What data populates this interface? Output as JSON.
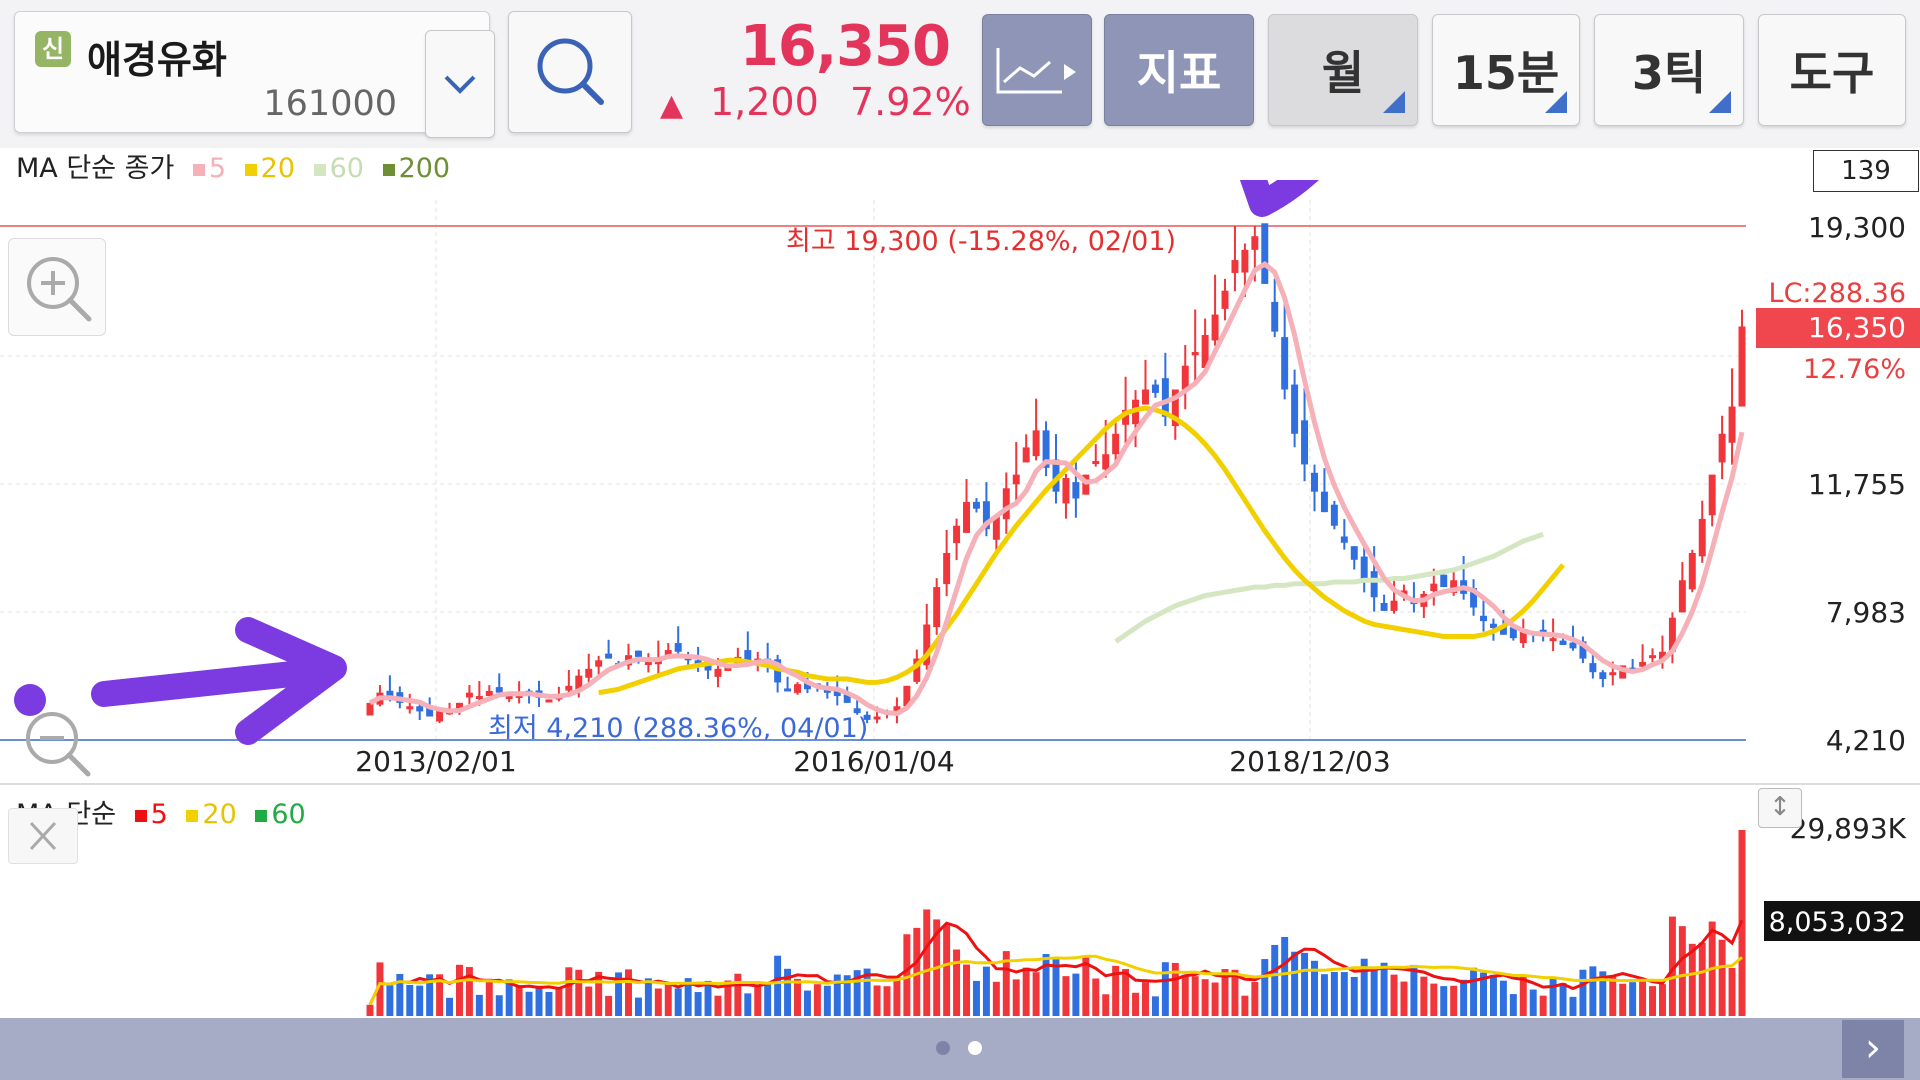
{
  "stock": {
    "badge": "신",
    "name": "애경유화",
    "code": "161000",
    "price": "16,350",
    "change_arrow": "▲",
    "change": "1,200",
    "change_pct": "7.92%"
  },
  "toolbar": {
    "chart_type_icon": "line-chart-icon",
    "indicator_label": "지표",
    "period_month": "월",
    "period_15min": "15분",
    "tick_3": "3틱",
    "tools": "도구"
  },
  "price_chart": {
    "legend_title": "MA 단순 종가",
    "legend_items": [
      {
        "label": "5",
        "color": "#f6b0b8"
      },
      {
        "label": "20",
        "color": "#f2d000"
      },
      {
        "label": "60",
        "color": "#d4e6c2"
      },
      {
        "label": "200",
        "color": "#6e8f33"
      }
    ],
    "candle_count": "139",
    "high_annotation": "최고 19,300 (-15.28%, 02/01)",
    "low_annotation": "최저 4,210 (288.36%, 04/01)",
    "lc_label": "LC:288.36",
    "current_price_tag": "16,350",
    "current_pct": "12.76%",
    "y_ticks": [
      "19,300",
      "11,755",
      "7,983",
      "4,210"
    ],
    "x_ticks": [
      "2013/02/01",
      "2016/01/04",
      "2018/12/03"
    ]
  },
  "volume_chart": {
    "legend_title": "MA 단순",
    "legend_items": [
      {
        "label": "5",
        "color": "#ee1111"
      },
      {
        "label": "20",
        "color": "#f2d000"
      },
      {
        "label": "60",
        "color": "#22aa44"
      }
    ],
    "max_label": "29,893K",
    "current_volume": "8,053,032"
  },
  "chart_data": {
    "type": "candlestick",
    "title": "애경유화",
    "interval": "월",
    "x_ticks": [
      "2013/02/01",
      "2016/01/04",
      "2018/12/03"
    ],
    "ylim": [
      4210,
      19300
    ],
    "y_ticks": [
      19300,
      11755,
      7983,
      4210
    ],
    "price_series": [
      5300,
      5600,
      5450,
      5300,
      5200,
      5050,
      4900,
      5100,
      5050,
      5300,
      5600,
      5500,
      5650,
      5600,
      5500,
      5600,
      5500,
      5450,
      5400,
      5550,
      5800,
      6100,
      6300,
      6550,
      6600,
      6400,
      6700,
      6650,
      6500,
      6600,
      6850,
      6800,
      6550,
      6400,
      6250,
      6300,
      6400,
      6650,
      6550,
      6600,
      6450,
      5900,
      5650,
      5850,
      5700,
      5800,
      5650,
      5500,
      5300,
      5000,
      4800,
      4900,
      5050,
      5200,
      5800,
      6600,
      7600,
      8700,
      9700,
      10500,
      11200,
      11000,
      10400,
      10800,
      11600,
      12000,
      12800,
      13300,
      12200,
      11500,
      11900,
      11300,
      12000,
      12400,
      12600,
      13200,
      13900,
      14200,
      14500,
      14400,
      13700,
      14500,
      15200,
      15600,
      16100,
      16700,
      17400,
      18300,
      18600,
      19000,
      17600,
      16200,
      14500,
      13200,
      12300,
      11500,
      10900,
      10500,
      10000,
      9500,
      8900,
      8400,
      8000,
      8300,
      8600,
      8200,
      8500,
      8800,
      8700,
      8900,
      8500,
      8100,
      7700,
      7500,
      7300,
      7200,
      7400,
      7300,
      7400,
      7200,
      7000,
      6900,
      6600,
      6200,
      6000,
      6200,
      6400,
      6300,
      6500,
      6700,
      6800,
      7800,
      8900,
      9700,
      10700,
      12000,
      13200,
      14000,
      16350
    ],
    "ma20": [
      null,
      null,
      null,
      null,
      null,
      null,
      null,
      null,
      null,
      null,
      null,
      null,
      null,
      null,
      null,
      null,
      null,
      null,
      null,
      null,
      null,
      null,
      null,
      5600,
      5650,
      5700,
      5800,
      5900,
      6000,
      6100,
      6200,
      6300,
      6350,
      6400,
      6450,
      6500,
      6550,
      6550,
      6500,
      6450,
      6400,
      6300,
      6250,
      6200,
      6100,
      6050,
      6000,
      6000,
      6000,
      5950,
      5900,
      5900,
      5950,
      6050,
      6200,
      6400,
      6700,
      7100,
      7500,
      7900,
      8350,
      8800,
      9250,
      9700,
      10100,
      10500,
      10850,
      11200,
      11550,
      11850,
      12150,
      12450,
      12750,
      13050,
      13350,
      13600,
      13800,
      13900,
      13950,
      13900,
      13800,
      13650,
      13450,
      13200,
      12900,
      12550,
      12150,
      11700,
      11250,
      10800,
      10350,
      9950,
      9550,
      9200,
      8900,
      8650,
      8400,
      8200,
      8000,
      7850,
      7700,
      7600,
      7550,
      7500,
      7450,
      7400,
      7350,
      7300,
      7250,
      7250,
      7250,
      7250,
      7300,
      7400,
      7550,
      7750,
      8000,
      8300,
      8650,
      9000,
      9350
    ],
    "ma60": [
      null,
      null,
      null,
      null,
      null,
      null,
      null,
      null,
      null,
      null,
      null,
      null,
      null,
      null,
      null,
      null,
      null,
      null,
      null,
      null,
      null,
      null,
      null,
      null,
      null,
      null,
      null,
      null,
      null,
      null,
      null,
      null,
      null,
      null,
      null,
      null,
      null,
      null,
      null,
      null,
      null,
      null,
      null,
      null,
      null,
      null,
      null,
      null,
      null,
      null,
      null,
      null,
      null,
      null,
      null,
      null,
      null,
      null,
      null,
      null,
      null,
      null,
      null,
      null,
      null,
      null,
      null,
      null,
      null,
      null,
      null,
      null,
      null,
      null,
      null,
      7100,
      7300,
      7500,
      7700,
      7850,
      8000,
      8150,
      8250,
      8350,
      8450,
      8500,
      8550,
      8600,
      8650,
      8700,
      8700,
      8750,
      8750,
      8800,
      8800,
      8800,
      8800,
      8850,
      8850,
      8850,
      8900,
      8900,
      8900,
      8950,
      8950,
      9000,
      9050,
      9100,
      9150,
      9200,
      9300,
      9400,
      9500,
      9600,
      9750,
      9900,
      10050,
      10150,
      10250
    ],
    "volume_max_k": 29893,
    "volume_current": 8053032,
    "high": 19300,
    "low": 4210
  }
}
